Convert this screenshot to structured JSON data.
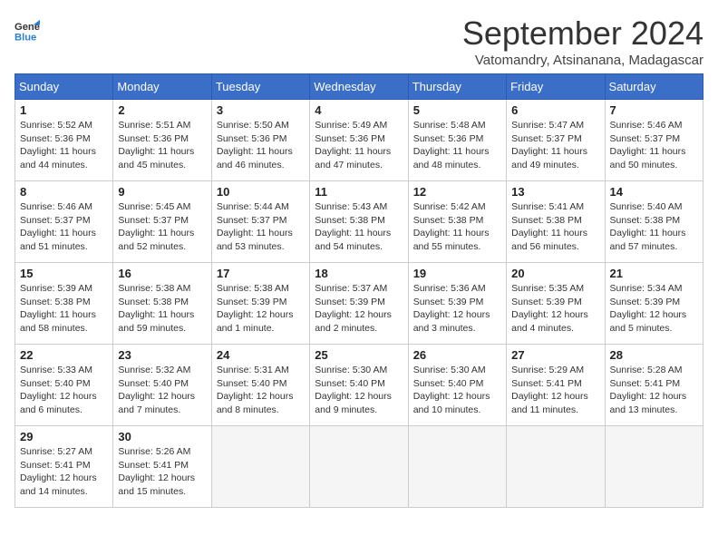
{
  "header": {
    "logo_line1": "General",
    "logo_line2": "Blue",
    "month_title": "September 2024",
    "subtitle": "Vatomandry, Atsinanana, Madagascar"
  },
  "days_of_week": [
    "Sunday",
    "Monday",
    "Tuesday",
    "Wednesday",
    "Thursday",
    "Friday",
    "Saturday"
  ],
  "weeks": [
    [
      {
        "day": "1",
        "info": "Sunrise: 5:52 AM\nSunset: 5:36 PM\nDaylight: 11 hours\nand 44 minutes."
      },
      {
        "day": "2",
        "info": "Sunrise: 5:51 AM\nSunset: 5:36 PM\nDaylight: 11 hours\nand 45 minutes."
      },
      {
        "day": "3",
        "info": "Sunrise: 5:50 AM\nSunset: 5:36 PM\nDaylight: 11 hours\nand 46 minutes."
      },
      {
        "day": "4",
        "info": "Sunrise: 5:49 AM\nSunset: 5:36 PM\nDaylight: 11 hours\nand 47 minutes."
      },
      {
        "day": "5",
        "info": "Sunrise: 5:48 AM\nSunset: 5:36 PM\nDaylight: 11 hours\nand 48 minutes."
      },
      {
        "day": "6",
        "info": "Sunrise: 5:47 AM\nSunset: 5:37 PM\nDaylight: 11 hours\nand 49 minutes."
      },
      {
        "day": "7",
        "info": "Sunrise: 5:46 AM\nSunset: 5:37 PM\nDaylight: 11 hours\nand 50 minutes."
      }
    ],
    [
      {
        "day": "8",
        "info": "Sunrise: 5:46 AM\nSunset: 5:37 PM\nDaylight: 11 hours\nand 51 minutes."
      },
      {
        "day": "9",
        "info": "Sunrise: 5:45 AM\nSunset: 5:37 PM\nDaylight: 11 hours\nand 52 minutes."
      },
      {
        "day": "10",
        "info": "Sunrise: 5:44 AM\nSunset: 5:37 PM\nDaylight: 11 hours\nand 53 minutes."
      },
      {
        "day": "11",
        "info": "Sunrise: 5:43 AM\nSunset: 5:38 PM\nDaylight: 11 hours\nand 54 minutes."
      },
      {
        "day": "12",
        "info": "Sunrise: 5:42 AM\nSunset: 5:38 PM\nDaylight: 11 hours\nand 55 minutes."
      },
      {
        "day": "13",
        "info": "Sunrise: 5:41 AM\nSunset: 5:38 PM\nDaylight: 11 hours\nand 56 minutes."
      },
      {
        "day": "14",
        "info": "Sunrise: 5:40 AM\nSunset: 5:38 PM\nDaylight: 11 hours\nand 57 minutes."
      }
    ],
    [
      {
        "day": "15",
        "info": "Sunrise: 5:39 AM\nSunset: 5:38 PM\nDaylight: 11 hours\nand 58 minutes."
      },
      {
        "day": "16",
        "info": "Sunrise: 5:38 AM\nSunset: 5:38 PM\nDaylight: 11 hours\nand 59 minutes."
      },
      {
        "day": "17",
        "info": "Sunrise: 5:38 AM\nSunset: 5:39 PM\nDaylight: 12 hours\nand 1 minute."
      },
      {
        "day": "18",
        "info": "Sunrise: 5:37 AM\nSunset: 5:39 PM\nDaylight: 12 hours\nand 2 minutes."
      },
      {
        "day": "19",
        "info": "Sunrise: 5:36 AM\nSunset: 5:39 PM\nDaylight: 12 hours\nand 3 minutes."
      },
      {
        "day": "20",
        "info": "Sunrise: 5:35 AM\nSunset: 5:39 PM\nDaylight: 12 hours\nand 4 minutes."
      },
      {
        "day": "21",
        "info": "Sunrise: 5:34 AM\nSunset: 5:39 PM\nDaylight: 12 hours\nand 5 minutes."
      }
    ],
    [
      {
        "day": "22",
        "info": "Sunrise: 5:33 AM\nSunset: 5:40 PM\nDaylight: 12 hours\nand 6 minutes."
      },
      {
        "day": "23",
        "info": "Sunrise: 5:32 AM\nSunset: 5:40 PM\nDaylight: 12 hours\nand 7 minutes."
      },
      {
        "day": "24",
        "info": "Sunrise: 5:31 AM\nSunset: 5:40 PM\nDaylight: 12 hours\nand 8 minutes."
      },
      {
        "day": "25",
        "info": "Sunrise: 5:30 AM\nSunset: 5:40 PM\nDaylight: 12 hours\nand 9 minutes."
      },
      {
        "day": "26",
        "info": "Sunrise: 5:30 AM\nSunset: 5:40 PM\nDaylight: 12 hours\nand 10 minutes."
      },
      {
        "day": "27",
        "info": "Sunrise: 5:29 AM\nSunset: 5:41 PM\nDaylight: 12 hours\nand 11 minutes."
      },
      {
        "day": "28",
        "info": "Sunrise: 5:28 AM\nSunset: 5:41 PM\nDaylight: 12 hours\nand 13 minutes."
      }
    ],
    [
      {
        "day": "29",
        "info": "Sunrise: 5:27 AM\nSunset: 5:41 PM\nDaylight: 12 hours\nand 14 minutes."
      },
      {
        "day": "30",
        "info": "Sunrise: 5:26 AM\nSunset: 5:41 PM\nDaylight: 12 hours\nand 15 minutes."
      },
      null,
      null,
      null,
      null,
      null
    ]
  ]
}
